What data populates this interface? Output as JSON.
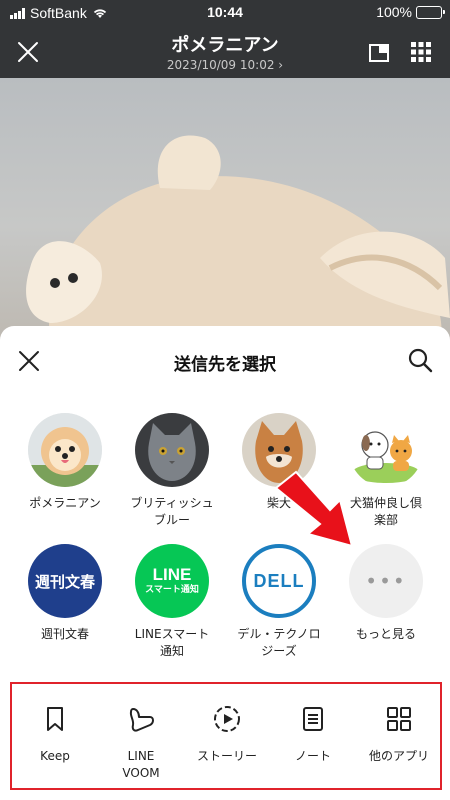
{
  "status": {
    "carrier": "SoftBank",
    "time": "10:44",
    "battery": "100%"
  },
  "header": {
    "title": "ポメラニアン",
    "subtitle": "2023/10/09 10:02 ›"
  },
  "sheet": {
    "title": "送信先を選択"
  },
  "recipients": [
    {
      "label": "ポメラニアン",
      "icon": "pomeranian-avatar"
    },
    {
      "label": "ブリティッシュブルー",
      "icon": "cat-avatar"
    },
    {
      "label": "柴犬",
      "icon": "shiba-avatar"
    },
    {
      "label": "犬猫仲良し倶楽部",
      "icon": "dog-cat-avatar"
    },
    {
      "label": "週刊文春",
      "icon": "bunshun-logo",
      "logo_text": "週刊文春"
    },
    {
      "label": "LINEスマート通知",
      "icon": "line-notification-logo",
      "logo_line1": "LINE",
      "logo_line2": "スマート通知"
    },
    {
      "label": "デル・テクノロジーズ",
      "icon": "dell-logo",
      "logo_text": "DELL"
    },
    {
      "label": "もっと見る",
      "icon": "more-dots-icon",
      "dots": "•••"
    }
  ],
  "apps": [
    {
      "label": "Keep",
      "icon": "bookmark-icon"
    },
    {
      "label": "LINE VOOM",
      "icon": "voom-icon"
    },
    {
      "label": "ストーリー",
      "icon": "story-play-icon"
    },
    {
      "label": "ノート",
      "icon": "note-icon"
    },
    {
      "label": "他のアプリ",
      "icon": "grid-apps-icon"
    }
  ],
  "colors": {
    "header_bg": "#333537",
    "highlight_border": "#e0232b",
    "arrow": "#e8111a",
    "line_green": "#06c755",
    "bunshun_blue": "#1f3f8c",
    "dell_blue": "#1b7ebf",
    "battery_green": "#45d05a"
  }
}
